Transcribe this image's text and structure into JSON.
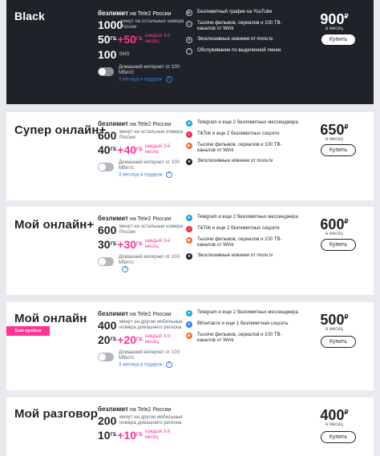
{
  "tariffs": [
    {
      "name": "Black",
      "unlimited_prefix": "безлимит",
      "unlimited_suffix": "на Tele2 России",
      "minutes": "1000",
      "minutes_note": "минут на остальные номера России",
      "gb_base": "50",
      "gb_unit": "ГБ",
      "gb_bonus": "+50",
      "gb_bonus_unit": "ГБ",
      "gb_note": "каждый 3-й месяц",
      "sms": "100",
      "sms_label": "SMS",
      "home_internet": "Домашний интернет от 100 Мбит/с",
      "home_gift": "3 месяца в подарок",
      "features": [
        {
          "icon": "youtube-icon",
          "text": "Безлимитный трафик на YouTube"
        },
        {
          "icon": "tv-icon",
          "text": "Тысячи фильмов, сериалов и 100 ТВ-каналов от Wink"
        },
        {
          "icon": "star-icon",
          "text": "Эксклюзивные новинки от more.tv"
        },
        {
          "icon": "headset-icon",
          "text": "Обслуживание по выделенной линии"
        }
      ],
      "price": "900",
      "currency": "₽",
      "period": "в месяц",
      "buy_label": "Купить"
    },
    {
      "name": "Супер онлайн+",
      "unlimited_prefix": "безлимит",
      "unlimited_suffix": "на Tele2 России",
      "minutes": "600",
      "minutes_note": "минут на остальные номера России",
      "gb_base": "40",
      "gb_unit": "ГБ",
      "gb_bonus": "+40",
      "gb_bonus_unit": "ГБ",
      "gb_note": "каждый 3-й месяц",
      "home_internet": "Домашний интернет от 100 Мбит/с",
      "home_gift": "3 месяца в подарок",
      "features": [
        {
          "icon": "telegram-icon",
          "text": "Telegram и еще 2 безлимитных мессенджера"
        },
        {
          "icon": "tiktok-icon",
          "text": "TikTok и еще 2 безлимитных соцсети"
        },
        {
          "icon": "tv-icon",
          "text": "Тысячи фильмов, сериалов и 100 ТВ-каналов от Wink"
        },
        {
          "icon": "star-icon",
          "text": "Эксклюзивные новинки от more.tv"
        }
      ],
      "price": "650",
      "currency": "₽",
      "period": "в месяц",
      "buy_label": "Купить"
    },
    {
      "name": "Мой онлайн+",
      "unlimited_prefix": "безлимит",
      "unlimited_suffix": "на Tele2 России",
      "minutes": "600",
      "minutes_note": "минут на остальные номера России",
      "gb_base": "30",
      "gb_unit": "ГБ",
      "gb_bonus": "+30",
      "gb_bonus_unit": "ГБ",
      "gb_note": "каждый 3-й месяц",
      "home_internet": "Домашний интернет от 100 Мбит/с",
      "home_gift": "",
      "features": [
        {
          "icon": "telegram-icon",
          "text": "Telegram и еще 2 безлимитных мессенджера"
        },
        {
          "icon": "tiktok-icon",
          "text": "TikTok и еще 2 безлимитных соцсети"
        },
        {
          "icon": "tv-icon",
          "text": "Тысячи фильмов, сериалов и 100 ТВ-каналов от Wink"
        },
        {
          "icon": "star-icon",
          "text": "Эксклюзивные новинки от more.tv"
        }
      ],
      "price": "600",
      "currency": "₽",
      "period": "в месяц",
      "buy_label": "Купить"
    },
    {
      "name": "Мой онлайн",
      "badge": "Хит продаж",
      "unlimited_prefix": "безлимит",
      "unlimited_suffix": "на Tele2 России",
      "minutes": "400",
      "minutes_note": "минут на другие мобильные номера домашнего региона",
      "gb_base": "20",
      "gb_unit": "ГБ",
      "gb_bonus": "+20",
      "gb_bonus_unit": "ГБ",
      "gb_note": "каждый 3-й месяц",
      "home_internet": "Домашний интернет от 100 Мбит/с",
      "home_gift": "3 месяца в подарок",
      "features": [
        {
          "icon": "telegram-icon",
          "text": "Telegram и еще 2 безлимитных мессенджера"
        },
        {
          "icon": "vk-icon",
          "text": "ВКонтакте и еще 1 безлимитная соцсеть"
        },
        {
          "icon": "tv-icon",
          "text": "Тысячи фильмов, сериалов и 100 ТВ-каналов от Wink"
        }
      ],
      "price": "500",
      "currency": "₽",
      "period": "в месяц",
      "buy_label": "Купить"
    },
    {
      "name": "Мой разговор",
      "unlimited_prefix": "безлимит",
      "unlimited_suffix": "на Tele2 России",
      "minutes": "200",
      "minutes_note": "минут на другие мобильные номера домашнего региона",
      "gb_base": "10",
      "gb_unit": "ГБ",
      "gb_bonus": "+10",
      "gb_bonus_unit": "ГБ",
      "gb_note": "каждый 3-й месяц",
      "price": "400",
      "currency": "₽",
      "period": "в месяц",
      "buy_label": "Купить"
    }
  ],
  "colors": {
    "accent": "#ff3495",
    "dark_bg": "#1f2229",
    "link": "#3b7ddd",
    "telegram": "#2aa3e0",
    "tiktok": "#e8344e",
    "vk": "#2787f5"
  }
}
